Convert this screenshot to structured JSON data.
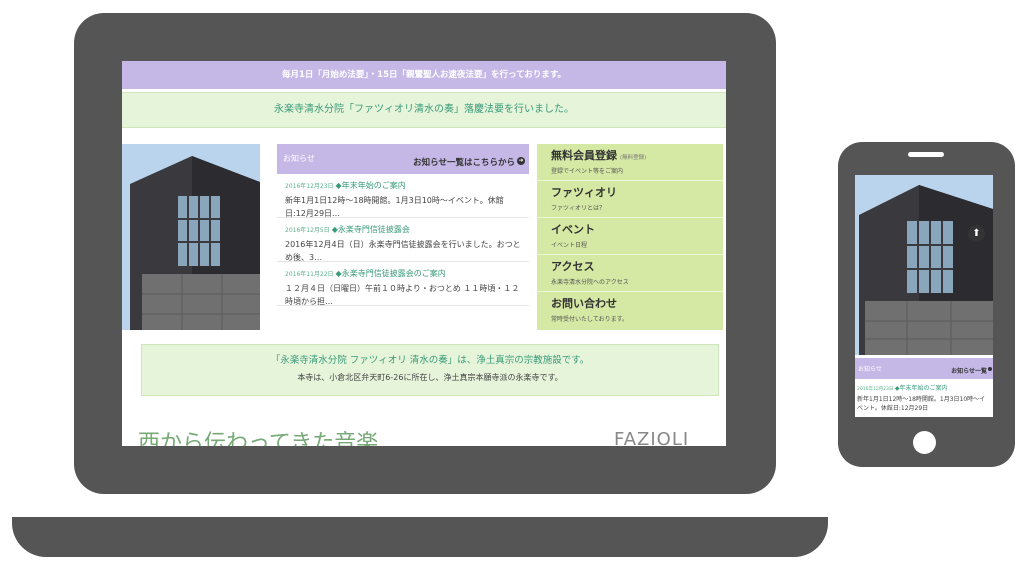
{
  "desktop": {
    "topbar": "毎月1日「月始め法要」・15日「親鸞聖人お逮夜法要」を行っております。",
    "announcement": "永楽寺清水分院「ファツィオリ清水の奏」落慶法要を行いました。",
    "news": {
      "heading": "お知らせ",
      "more_link": "お知らせ一覧はこちらから",
      "items": [
        {
          "date": "2016年12月23日",
          "title": "◆年末年始のご案内",
          "body": "新年1月1日12時〜18時開館。1月3日10時〜イベント。休館日:12月29日…"
        },
        {
          "date": "2016年12月5日",
          "title": "◆永楽寺門信徒披露会",
          "body": "2016年12月4日（日）永楽寺門信徒披露会を行いました。おつとめ後、3…"
        },
        {
          "date": "2016年11月22日",
          "title": "◆永楽寺門信徒披露会のご案内",
          "body": "１２月４日（日曜日）午前１０時より・おつとめ １１時頃・１２時頃から担…"
        }
      ]
    },
    "menu": [
      {
        "label": "無料会員登録",
        "note": "(無料登録)",
        "sub": "登録でイベント等をご案内"
      },
      {
        "label": "ファツィオリ",
        "note": "",
        "sub": "ファツィオリとは？"
      },
      {
        "label": "イベント",
        "note": "",
        "sub": "イベント日程"
      },
      {
        "label": "アクセス",
        "note": "",
        "sub": "永楽寺清水分院へのアクセス"
      },
      {
        "label": "お問い合わせ",
        "note": "",
        "sub": "常時受付いたしております。"
      }
    ],
    "info": {
      "title": "「永楽寺清水分院 ファツィオリ 清水の奏」は、浄土真宗の宗教施設です。",
      "sub": "本寺は、小倉北区弁天町6-26に所在し、浄土真宗本願寺派の永楽寺です。"
    },
    "banner": {
      "kanji": "西から伝わってきた音楽",
      "logo": "FAZIOLI"
    }
  },
  "mobile": {
    "news_heading": "お知らせ",
    "news_link": "お知らせ一覧",
    "item": {
      "date": "2016年12月23日",
      "title": "◆年末年始のご案内",
      "body": "新年1月1日12時〜18時開館。1月3日10時〜イベント。休館日:12月29日"
    }
  }
}
